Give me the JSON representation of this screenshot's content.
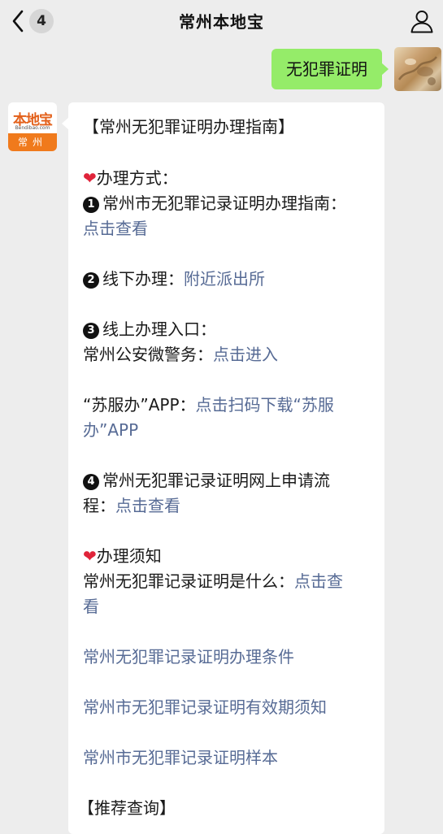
{
  "navbar": {
    "title": "常州本地宝",
    "unread_count": "4"
  },
  "outgoing": {
    "text": "无犯罪证明"
  },
  "brand_avatar": {
    "logo_text": "本地宝",
    "logo_url_text": "Bendibao.com",
    "city": "常州"
  },
  "message": {
    "title": "【常州无犯罪证明办理指南】",
    "section1_heading": "办理方式：",
    "item1_num": "1",
    "item1_text": "常州市无犯罪记录证明办理指南：",
    "item1_link": "点击查看",
    "item2_num": "2",
    "item2_text": "线下办理：",
    "item2_link": "附近派出所",
    "item3_num": "3",
    "item3_text": "线上办理入口：",
    "item3_sub1_text": "常州公安微警务：",
    "item3_sub1_link": "点击进入",
    "item3_sub2_text": "“苏服办”APP：",
    "item3_sub2_link_a": "点击扫码下载“苏服",
    "item3_sub2_link_b": "办”APP",
    "item4_num": "4",
    "item4_text_a": "常州无犯罪记录证明网上申请流",
    "item4_text_b": "程：",
    "item4_link": "点击查看",
    "section2_heading": "办理须知",
    "notice1_text": "常州无犯罪记录证明是什么：",
    "notice1_link_a": "点击查",
    "notice1_link_b": "看",
    "notice2_link": "常州无犯罪记录证明办理条件",
    "notice3_link": "常州市无犯罪记录证明有效期须知",
    "notice4_link": "常州市无犯罪记录证明样本",
    "recommend_heading": "【推荐查询】"
  },
  "colors": {
    "link": "#576b95",
    "outgoing_bubble": "#95ec69",
    "background": "#ededed",
    "heart": "#e0243a",
    "brand_orange": "#f07a1c"
  },
  "icons": {
    "back": "chevron-left-icon",
    "profile": "person-icon",
    "heart": "heart-icon"
  }
}
